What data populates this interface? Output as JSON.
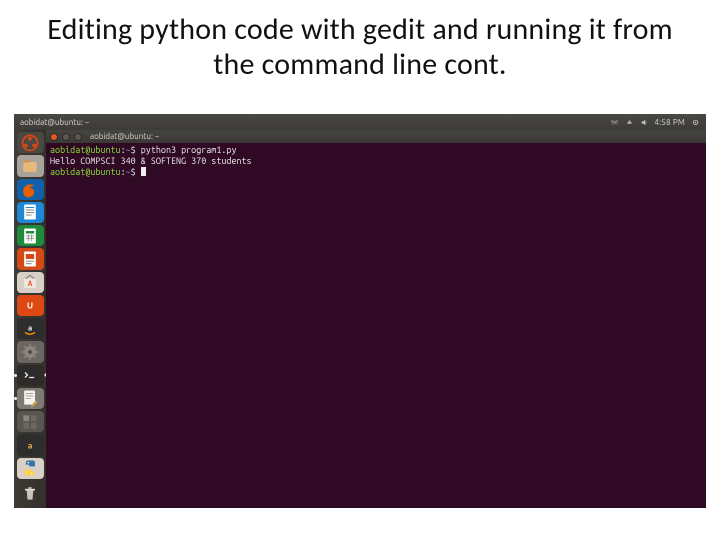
{
  "slide": {
    "title": "Editing python code with gedit and running it from the command line cont."
  },
  "menubar": {
    "window_title": "aobidat@ubuntu: ~",
    "time": "4:58 PM"
  },
  "termbar": {
    "title": "aobidat@ubuntu: ~"
  },
  "launcher": {
    "items": [
      {
        "name": "dash",
        "bg": "#4b4743"
      },
      {
        "name": "nautilus",
        "bg": "#a9a29a"
      },
      {
        "name": "firefox",
        "bg": "#1260a9"
      },
      {
        "name": "libre-writer",
        "bg": "#1e87d6"
      },
      {
        "name": "libre-calc",
        "bg": "#1f8a3b"
      },
      {
        "name": "libre-impress",
        "bg": "#d44a17"
      },
      {
        "name": "software-center",
        "bg": "#d8cfc6"
      },
      {
        "name": "ubuntu-one",
        "bg": "#dd4814"
      },
      {
        "name": "amazon",
        "bg": "#2d2d2d"
      },
      {
        "name": "settings",
        "bg": "#6b6561"
      },
      {
        "name": "terminal",
        "bg": "#2e2a27",
        "running": true,
        "active": true
      },
      {
        "name": "gedit",
        "bg": "#807a74",
        "running": true
      },
      {
        "name": "workspace",
        "bg": "#595551"
      },
      {
        "name": "item-a",
        "bg": "#2d2d2d"
      },
      {
        "name": "python",
        "bg": "#d8cfc6"
      }
    ],
    "trash": {
      "name": "trash",
      "bg": "transparent"
    }
  },
  "terminal": {
    "lines": [
      {
        "user": "aobidat@ubuntu",
        "path": "~",
        "cmd": "python3 program1.py"
      },
      {
        "plain": "Hello COMPSCI 340 & SOFTENG 370 students"
      },
      {
        "user": "aobidat@ubuntu",
        "path": "~",
        "cmd": "",
        "cursor": true
      }
    ]
  }
}
